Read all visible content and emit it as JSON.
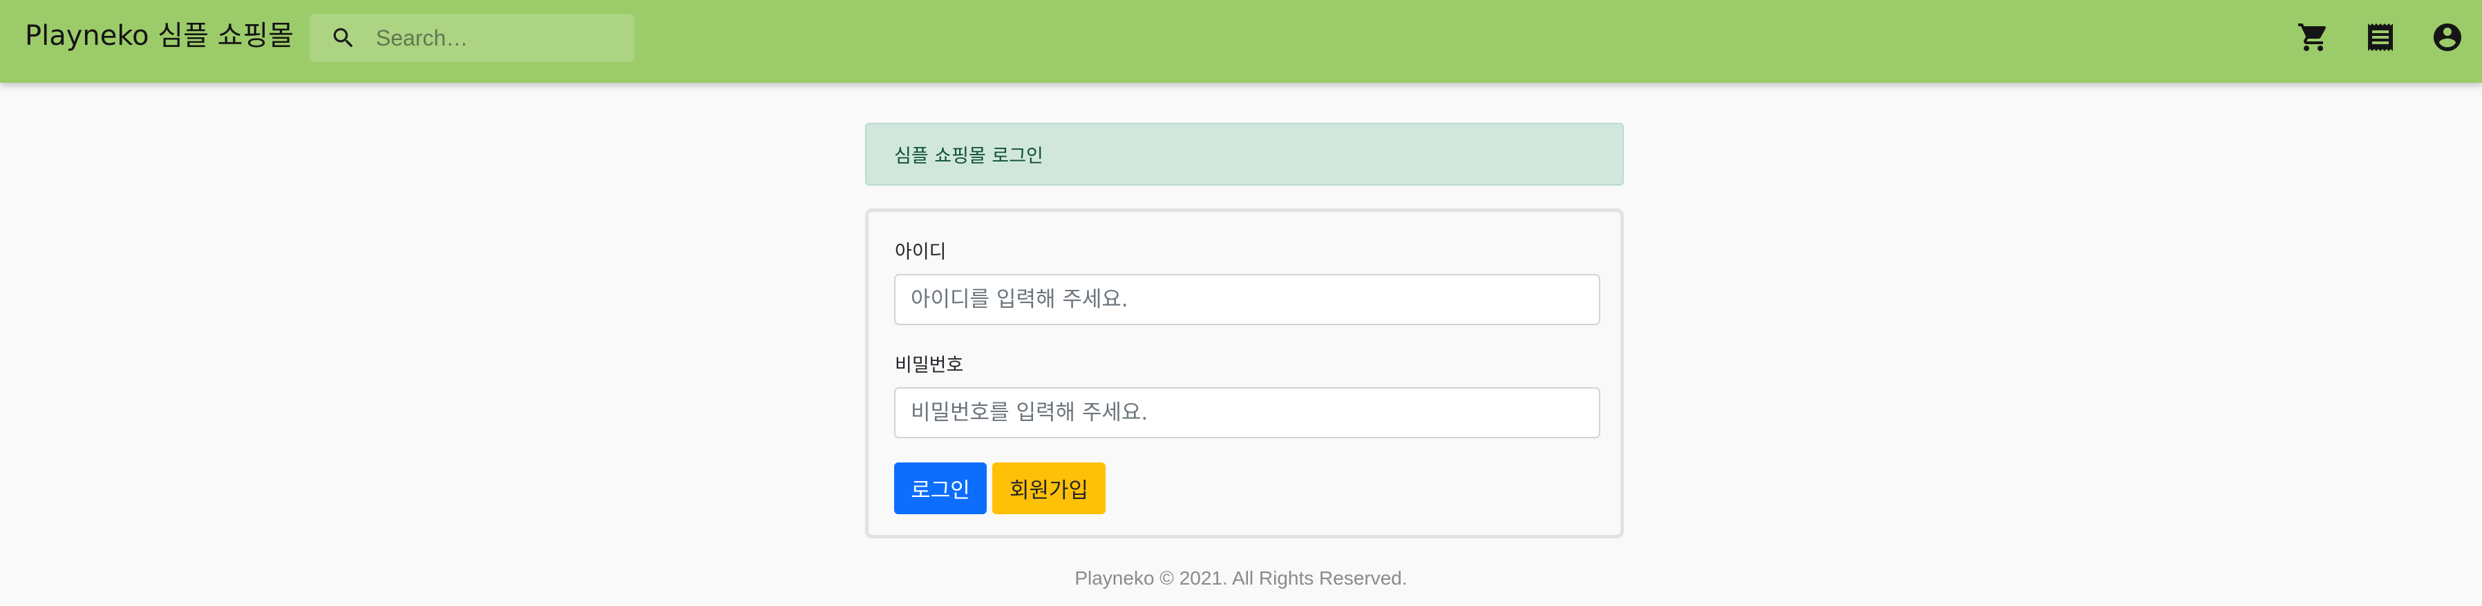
{
  "header": {
    "brand": "Playneko 심플 쇼핑몰",
    "search": {
      "placeholder": "Search…",
      "icon": "search-icon"
    },
    "actions": [
      {
        "icon": "cart-icon"
      },
      {
        "icon": "receipt-icon"
      },
      {
        "icon": "account-circle-icon"
      }
    ]
  },
  "alert": {
    "text": "심플 쇼핑몰 로그인"
  },
  "login_form": {
    "id_label": "아이디",
    "id_placeholder": "아이디를 입력해 주세요.",
    "password_label": "비밀번호",
    "password_placeholder": "비밀번호를 입력해 주세요.",
    "login_button": "로그인",
    "signup_button": "회원가입"
  },
  "footer": {
    "text": "Playneko © 2021. All Rights Reserved."
  },
  "colors": {
    "appbar": "#9ccc6a",
    "alert_bg": "#d1e7dd",
    "primary": "#0d6efd",
    "warning": "#ffc107"
  }
}
